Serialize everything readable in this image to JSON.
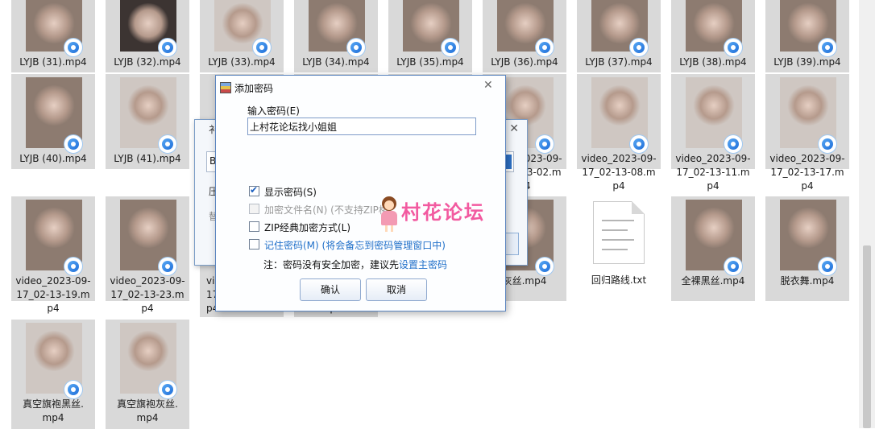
{
  "files": [
    {
      "name": "LYJB (31).mp4",
      "col": 0,
      "row": 0,
      "kind": "video"
    },
    {
      "name": "LYJB (32).mp4",
      "col": 1,
      "row": 0,
      "kind": "video-dark"
    },
    {
      "name": "LYJB (33).mp4",
      "col": 2,
      "row": 0,
      "kind": "video-light"
    },
    {
      "name": "LYJB (34).mp4",
      "col": 3,
      "row": 0,
      "kind": "video"
    },
    {
      "name": "LYJB (35).mp4",
      "col": 4,
      "row": 0,
      "kind": "video"
    },
    {
      "name": "LYJB (36).mp4",
      "col": 5,
      "row": 0,
      "kind": "video"
    },
    {
      "name": "LYJB (37).mp4",
      "col": 6,
      "row": 0,
      "kind": "video"
    },
    {
      "name": "LYJB (38).mp4",
      "col": 7,
      "row": 0,
      "kind": "video"
    },
    {
      "name": "LYJB (39).mp4",
      "col": 8,
      "row": 0,
      "kind": "video"
    },
    {
      "name": "LYJB (40).mp4",
      "col": 0,
      "row": 1,
      "kind": "video"
    },
    {
      "name": "LYJB (41).mp4",
      "col": 1,
      "row": 1,
      "kind": "video-light"
    },
    {
      "name": "video_2023-09-17_02-13-02.mp4",
      "col": 5,
      "row": 1,
      "kind": "video-light",
      "lines": [
        "video_2023-09-",
        "17_02-13-02.m",
        "p4"
      ]
    },
    {
      "name": "video_2023-09-17_02-13-08.mp4",
      "col": 6,
      "row": 1,
      "kind": "video-light",
      "lines": [
        "video_2023-09-",
        "17_02-13-08.m",
        "p4"
      ]
    },
    {
      "name": "video_2023-09-17_02-13-11.mp4",
      "col": 7,
      "row": 1,
      "kind": "video-light",
      "lines": [
        "video_2023-09-",
        "17_02-13-11.m",
        "p4"
      ]
    },
    {
      "name": "video_2023-09-17_02-13-17.mp4",
      "col": 8,
      "row": 1,
      "kind": "video-light",
      "lines": [
        "video_2023-09-",
        "17_02-13-17.m",
        "p4"
      ]
    },
    {
      "name": "video_2023-09-17_02-13-19.mp4",
      "col": 0,
      "row": 2,
      "kind": "video",
      "lines": [
        "video_2023-09-",
        "17_02-13-19.m",
        "p4"
      ]
    },
    {
      "name": "video_2023-09-17_02-13-23.mp4",
      "col": 1,
      "row": 2,
      "kind": "video",
      "lines": [
        "video_2023-09-",
        "17_02-13-23.m",
        "p4"
      ]
    },
    {
      "name": "灰丝.mp4",
      "col": 5,
      "row": 2,
      "kind": "video"
    },
    {
      "name": "回归路线.txt",
      "col": 6,
      "row": 2,
      "kind": "text"
    },
    {
      "name": "全裸黑丝.mp4",
      "col": 7,
      "row": 2,
      "kind": "video"
    },
    {
      "name": "脱衣舞.mp4",
      "col": 8,
      "row": 2,
      "kind": "video"
    },
    {
      "name": "真空旗袍黑丝.mp4",
      "col": 0,
      "row": 3,
      "kind": "video-light",
      "lines": [
        "真空旗袍黑丝.",
        "mp4"
      ]
    },
    {
      "name": "真空旗袍灰丝.mp4",
      "col": 1,
      "row": 3,
      "kind": "video-light",
      "lines": [
        "真空旗袍灰丝.",
        "mp4"
      ]
    }
  ],
  "partial_labels": {
    "col2_row2": [
      "vi",
      "17",
      "p4"
    ],
    "col3_row2": [
      "p4"
    ]
  },
  "back_dialog": {
    "title_fragment": "衤",
    "field_fragment": "B",
    "line1_fragment": "压",
    "line2_fragment": "替"
  },
  "dialog": {
    "title": "添加密码",
    "password_label": "输入密码(E)",
    "password_value": "上村花论坛找小姐姐",
    "show_password": {
      "label": "显示密码(S)",
      "checked": true,
      "enabled": true
    },
    "encrypt_filenames": {
      "label": "加密文件名(N)",
      "hint": "(不支持ZIP格",
      "checked": false,
      "enabled": false
    },
    "zip_classic": {
      "label": "ZIP经典加密方式(L)",
      "checked": false,
      "enabled": true
    },
    "remember": {
      "label": "记住密码(M)",
      "hint": "(将会备忘到密码管理窗口中)",
      "checked": false,
      "enabled": true
    },
    "note_prefix": "注：密码没有安全加密，建议先",
    "note_link": "设置主密码",
    "ok_label": "确认",
    "cancel_label": "取消"
  },
  "watermark": {
    "text": "村花论坛"
  },
  "colors": {
    "tile_bg": "#d9d9d9",
    "accent": "#1f6fc9",
    "watermark": "#f25aa0"
  }
}
